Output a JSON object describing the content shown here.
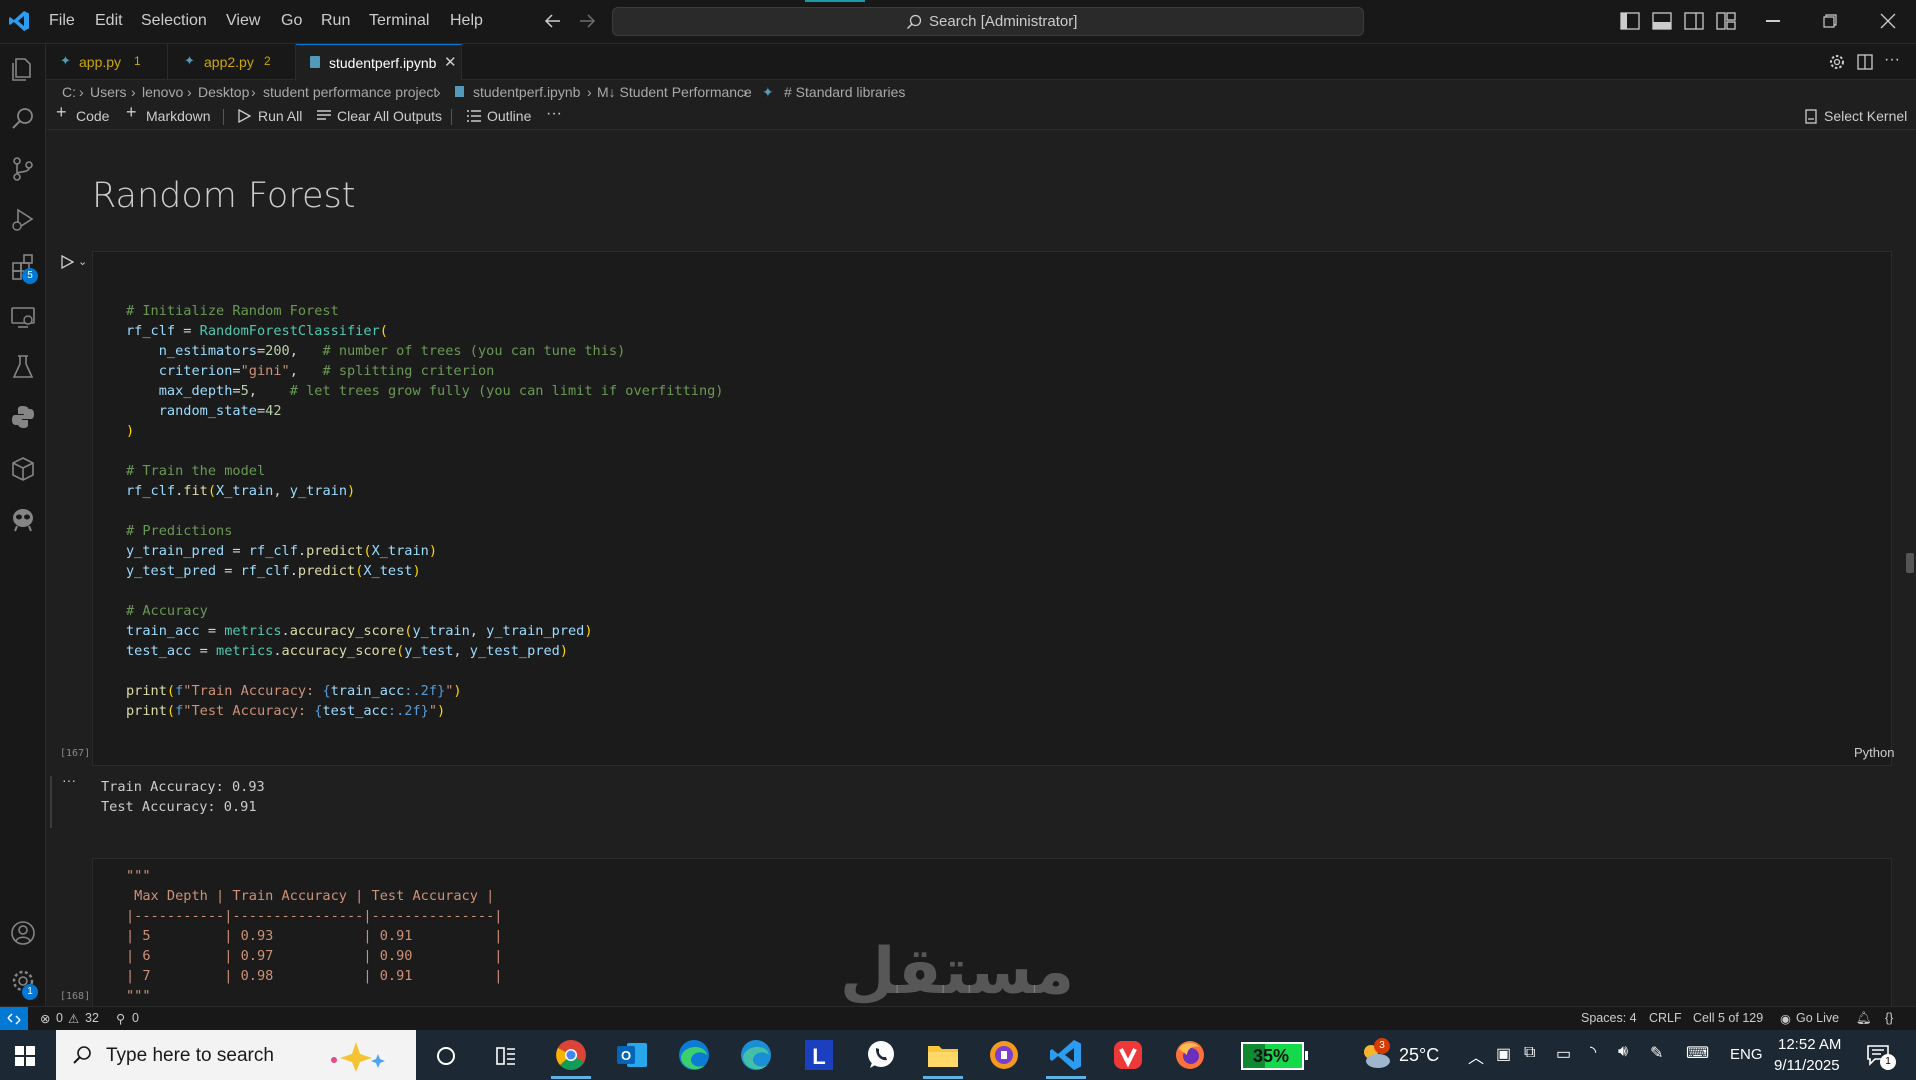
{
  "titlebar": {
    "menu": [
      "File",
      "Edit",
      "Selection",
      "View",
      "Go",
      "Run",
      "Terminal",
      "Help"
    ],
    "search_text": "Search [Administrator]"
  },
  "activitybar": {
    "extensions_badge": "5",
    "settings_badge": "1"
  },
  "tabs": [
    {
      "label": "app.py",
      "badge": "1",
      "color": "#cca700"
    },
    {
      "label": "app2.py",
      "badge": "2",
      "color": "#cca700"
    },
    {
      "label": "studentperf.ipynb",
      "badge": "",
      "color": "#ffffff"
    }
  ],
  "breadcrumb": {
    "items": [
      "C:",
      "Users",
      "lenovo",
      "Desktop",
      "student performance project",
      "studentperf.ipynb",
      "M↓ Student Performance",
      "# Standard libraries"
    ]
  },
  "toolbar": {
    "code": "Code",
    "markdown": "Markdown",
    "run_all": "Run All",
    "clear_outputs": "Clear All Outputs",
    "outline": "Outline",
    "more": "···",
    "select_kernel": "Select Kernel"
  },
  "notebook": {
    "heading": "Random Forest",
    "cell_exec_count": "[167]",
    "language": "Python",
    "output_lines": [
      "Train Accuracy: 0.93",
      "Test Accuracy: 0.91"
    ],
    "output_more": "···",
    "cell2_exec_count": "[168]",
    "md_lines": [
      "\"\"\"",
      " Max Depth | Train Accuracy | Test Accuracy |",
      "|-----------|----------------|---------------|",
      "| 5         | 0.93           | 0.91          |",
      "| 6         | 0.97           | 0.90          |",
      "| 7         | 0.98           | 0.91          |",
      "\"\"\""
    ]
  },
  "statusbar": {
    "errors": "0",
    "warnings": "32",
    "ports": "0",
    "spaces": "Spaces: 4",
    "eol": "CRLF",
    "cell": "Cell 5 of 129",
    "golive": "Go Live"
  },
  "taskbar": {
    "search_placeholder": "Type here to search",
    "battery": "35%",
    "weather": "25°C",
    "weather_badge": "3",
    "lang": "ENG",
    "time": "12:52 AM",
    "date": "9/11/2025",
    "notif_badge": "1"
  },
  "watermark": "مستقل"
}
